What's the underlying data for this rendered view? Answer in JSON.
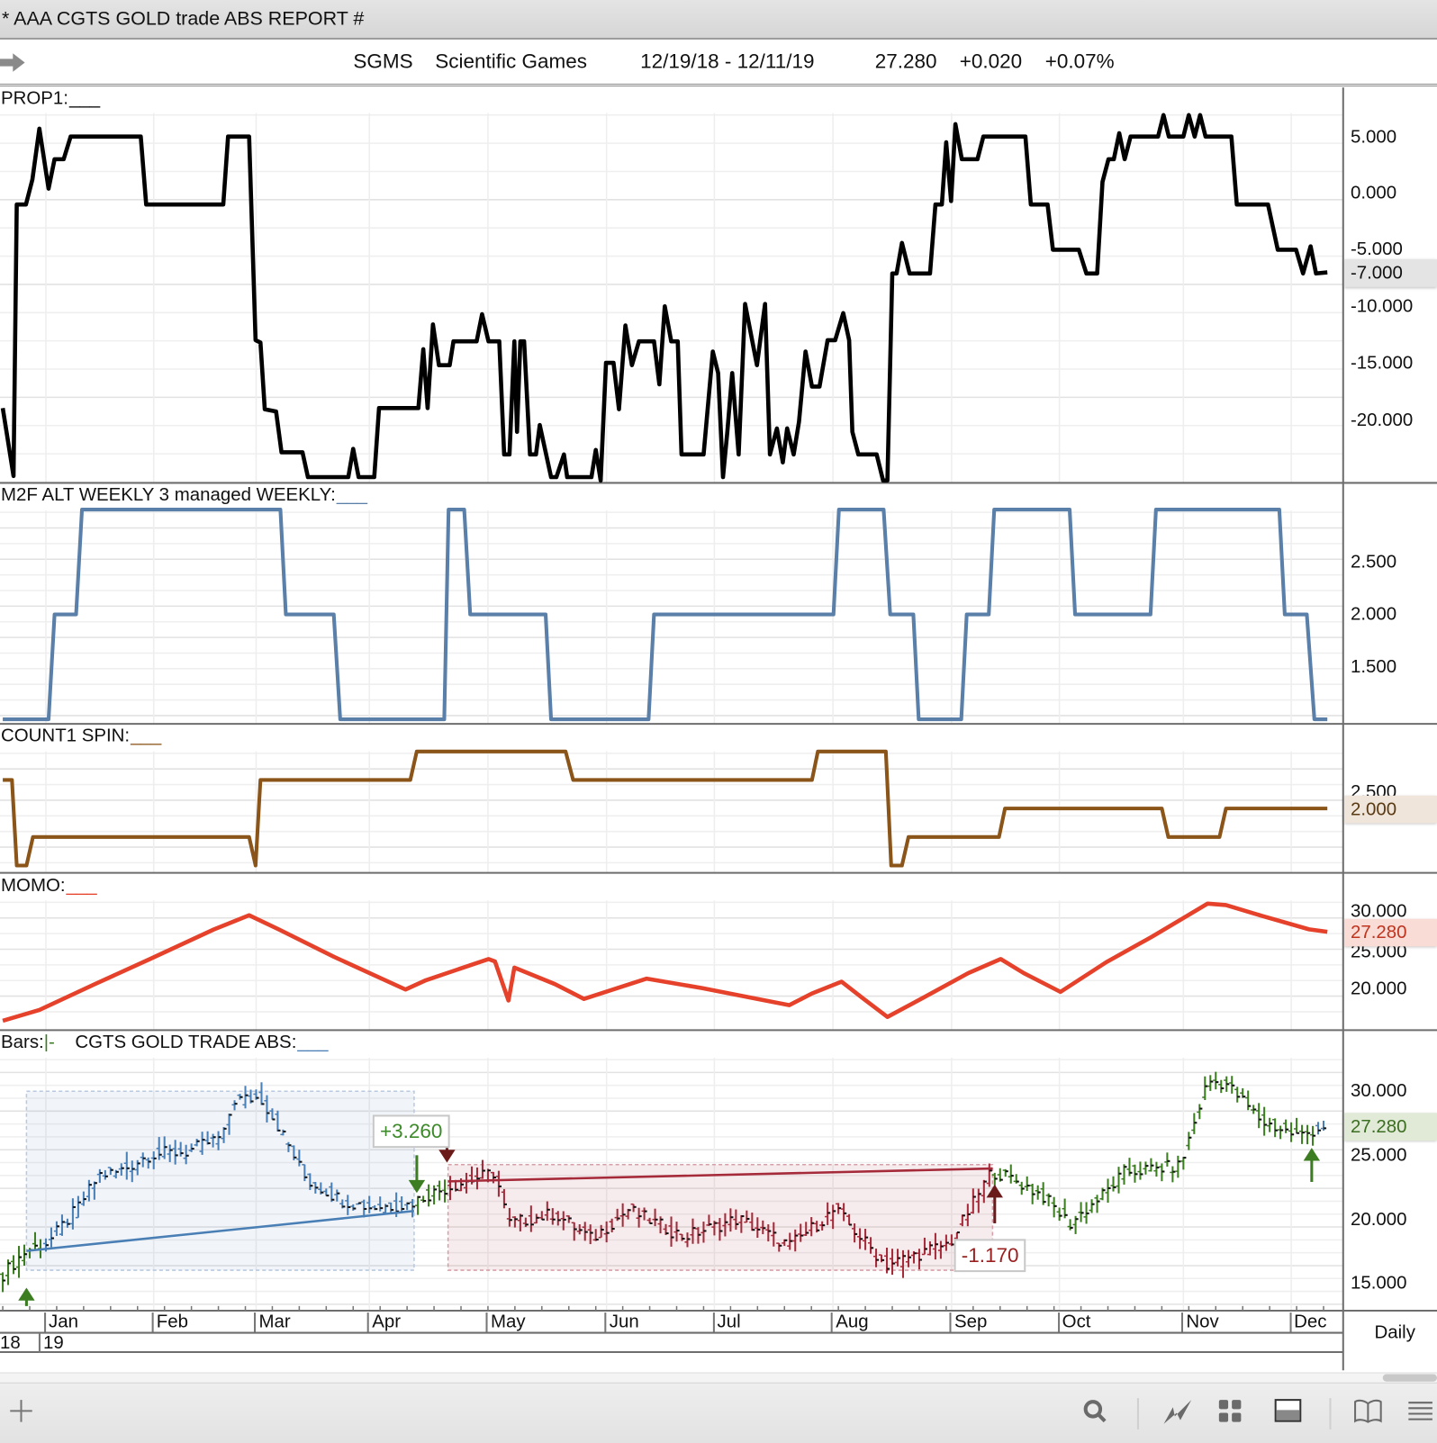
{
  "window": {
    "title": "*  AAA CGTS GOLD trade ABS REPORT #"
  },
  "info": {
    "symbol": "SGMS",
    "name": "Scientific Games",
    "range": "12/19/18 - 12/11/19",
    "last": "27.280",
    "change": "+0.020",
    "change_pct": "+0.07%"
  },
  "panels": {
    "prop1": {
      "label": "PROP1:",
      "underline": "___",
      "color": "#000000",
      "ticks": [
        "5.000",
        "0.000",
        "-5.000",
        "-10.000",
        "-15.000",
        "-20.000"
      ],
      "last": "-7.000"
    },
    "m2f": {
      "label": "M2F ALT WEEKLY 3 managed WEEKLY:",
      "underline": "___",
      "color": "#5a7fa8",
      "ticks": [
        "2.500",
        "2.000",
        "1.500"
      ]
    },
    "count1": {
      "label": "COUNT1 SPIN:",
      "underline": "___",
      "color": "#8b5418",
      "ticks": [
        "2.500"
      ],
      "last": "2.000"
    },
    "momo": {
      "label": "MOMO:",
      "underline": "___",
      "color": "#e6412a",
      "ticks": [
        "30.000",
        "25.000",
        "20.000"
      ],
      "last": "27.280"
    },
    "bars": {
      "label": "Bars:",
      "bar_glyph": "|-",
      "study": "CGTS  GOLD TRADE ABS:",
      "underline": "___",
      "color": "#4a7fb5",
      "ticks": [
        "30.000",
        "25.000",
        "20.000",
        "15.000"
      ],
      "last": "27.280"
    }
  },
  "xaxis": {
    "months": [
      {
        "label": "Jan",
        "t": 8
      },
      {
        "label": "Feb",
        "t": 28
      },
      {
        "label": "Mar",
        "t": 47
      },
      {
        "label": "Apr",
        "t": 68
      },
      {
        "label": "May",
        "t": 90
      },
      {
        "label": "Jun",
        "t": 112
      },
      {
        "label": "Jul",
        "t": 132
      },
      {
        "label": "Aug",
        "t": 154
      },
      {
        "label": "Sep",
        "t": 176
      },
      {
        "label": "Oct",
        "t": 196
      },
      {
        "label": "Nov",
        "t": 219
      },
      {
        "label": "Dec",
        "t": 239
      }
    ],
    "years": [
      {
        "label": "18",
        "t": 0
      },
      {
        "label": "19",
        "t": 8
      }
    ],
    "period": "Daily"
  },
  "annotations": {
    "gain": "+3.260",
    "loss": "-1.170"
  },
  "colors": {
    "green": "#3c7d22",
    "blue": "#4a7fb5",
    "red": "#a52a3a",
    "darkred": "#6b1a1a"
  },
  "chart_data": [
    {
      "type": "line",
      "title": "PROP1",
      "ylim": [
        -25.6,
        9.3
      ],
      "x_unit": "trading day since 12/19/18",
      "points": [
        [
          0,
          -19
        ],
        [
          2,
          -25
        ],
        [
          2.6,
          -1
        ],
        [
          4.3,
          -1
        ],
        [
          5.5,
          1.2
        ],
        [
          6.8,
          5.7
        ],
        [
          8.5,
          0.4
        ],
        [
          9.6,
          3
        ],
        [
          11.3,
          3
        ],
        [
          12.6,
          5
        ],
        [
          25.6,
          5
        ],
        [
          26.6,
          -1
        ],
        [
          40.9,
          -1
        ],
        [
          41.8,
          5
        ],
        [
          45.7,
          5
        ],
        [
          46.9,
          -13
        ],
        [
          47.8,
          -13.2
        ],
        [
          48.6,
          -19.1
        ],
        [
          50.7,
          -19.3
        ],
        [
          51.7,
          -22.9
        ],
        [
          55.6,
          -22.9
        ],
        [
          56.6,
          -25.1
        ],
        [
          64.1,
          -25.1
        ],
        [
          65,
          -22.6
        ],
        [
          66,
          -25.1
        ],
        [
          68.9,
          -25.1
        ],
        [
          69.8,
          -19
        ],
        [
          77.1,
          -19
        ],
        [
          78,
          -13.8
        ],
        [
          78.8,
          -19
        ],
        [
          79.8,
          -11.6
        ],
        [
          80.9,
          -15.2
        ],
        [
          82.9,
          -15.2
        ],
        [
          83.6,
          -13.1
        ],
        [
          87.9,
          -13.1
        ],
        [
          88.9,
          -10.7
        ],
        [
          90.1,
          -13.1
        ],
        [
          92.1,
          -13.1
        ],
        [
          93,
          -23.1
        ],
        [
          94,
          -23.1
        ],
        [
          94.9,
          -13.1
        ],
        [
          95.4,
          -21.1
        ],
        [
          96,
          -13.1
        ],
        [
          96.7,
          -13.1
        ],
        [
          97.8,
          -23.1
        ],
        [
          98.9,
          -23.1
        ],
        [
          99.6,
          -20.5
        ],
        [
          101.7,
          -25.1
        ],
        [
          102.7,
          -25.1
        ],
        [
          104.1,
          -23.1
        ],
        [
          104.7,
          -25.1
        ],
        [
          109.2,
          -25.1
        ],
        [
          110,
          -22.7
        ],
        [
          110.9,
          -25.4
        ],
        [
          111.9,
          -15
        ],
        [
          113.3,
          -15
        ],
        [
          114.3,
          -19.1
        ],
        [
          115.5,
          -11.7
        ],
        [
          116.7,
          -15.2
        ],
        [
          118,
          -13.1
        ],
        [
          120.8,
          -13.1
        ],
        [
          121.8,
          -16.9
        ],
        [
          122.8,
          -10
        ],
        [
          124,
          -13.1
        ],
        [
          125.2,
          -13.1
        ],
        [
          125.9,
          -23.1
        ],
        [
          130,
          -23.1
        ],
        [
          131.7,
          -14
        ],
        [
          132.7,
          -15.9
        ],
        [
          133.6,
          -25.1
        ],
        [
          134.4,
          -21.1
        ],
        [
          135.3,
          -15.9
        ],
        [
          136.5,
          -23.1
        ],
        [
          137.7,
          -9.8
        ],
        [
          139.9,
          -15.2
        ],
        [
          141.4,
          -9.8
        ],
        [
          142.3,
          -23.1
        ],
        [
          143.6,
          -20.8
        ],
        [
          144.7,
          -23.8
        ],
        [
          145.5,
          -20.8
        ],
        [
          146.7,
          -23.1
        ],
        [
          147.7,
          -20.2
        ],
        [
          148.9,
          -14
        ],
        [
          150.1,
          -17.1
        ],
        [
          151.5,
          -17.1
        ],
        [
          153,
          -13
        ],
        [
          154.4,
          -13
        ],
        [
          155.9,
          -10.6
        ],
        [
          157,
          -13
        ],
        [
          157.6,
          -21.1
        ],
        [
          158.7,
          -23.1
        ],
        [
          162.1,
          -23.1
        ],
        [
          163.3,
          -25.4
        ],
        [
          164.1,
          -25.4
        ],
        [
          165,
          -7.1
        ],
        [
          165.8,
          -7.1
        ],
        [
          166.8,
          -4.4
        ],
        [
          168.2,
          -7.1
        ],
        [
          172,
          -7.1
        ],
        [
          173,
          -1
        ],
        [
          174.2,
          -1
        ],
        [
          175,
          4.5
        ],
        [
          175.9,
          -0.7
        ],
        [
          176.7,
          6.1
        ],
        [
          177.9,
          3
        ],
        [
          180.8,
          3
        ],
        [
          181.9,
          5
        ],
        [
          189.7,
          5
        ],
        [
          190.7,
          -1
        ],
        [
          193.8,
          -1
        ],
        [
          194.8,
          -5
        ],
        [
          199.6,
          -5
        ],
        [
          201,
          -7.1
        ],
        [
          203,
          -7.1
        ],
        [
          204,
          1
        ],
        [
          205.1,
          3
        ],
        [
          206.1,
          3
        ],
        [
          207.1,
          5.3
        ],
        [
          208.1,
          3
        ],
        [
          209.2,
          5
        ],
        [
          214.3,
          5
        ],
        [
          215.3,
          6.9
        ],
        [
          216.3,
          5
        ],
        [
          219,
          5
        ],
        [
          220,
          6.9
        ],
        [
          221.1,
          5
        ],
        [
          222.1,
          6.9
        ],
        [
          223.1,
          5
        ],
        [
          227.9,
          5
        ],
        [
          228.9,
          -1
        ],
        [
          234.7,
          -1
        ],
        [
          236.5,
          -5
        ],
        [
          239.9,
          -5
        ],
        [
          241.2,
          -7.1
        ],
        [
          242.6,
          -4.7
        ],
        [
          243.6,
          -7.1
        ],
        [
          245.7,
          -7
        ]
      ]
    },
    {
      "type": "line",
      "title": "M2F ALT WEEKLY 3 managed WEEKLY",
      "ylim": [
        0.97,
        3.2
      ],
      "points": [
        [
          0,
          1
        ],
        [
          8.5,
          1
        ],
        [
          9.6,
          2
        ],
        [
          13.6,
          2
        ],
        [
          14.7,
          3
        ],
        [
          51.5,
          3
        ],
        [
          52.5,
          2
        ],
        [
          61.4,
          2
        ],
        [
          62.6,
          1
        ],
        [
          81.9,
          1
        ],
        [
          82.7,
          3
        ],
        [
          85.6,
          3
        ],
        [
          86.7,
          2
        ],
        [
          100.7,
          2
        ],
        [
          101.7,
          1
        ],
        [
          119.8,
          1
        ],
        [
          120.8,
          2
        ],
        [
          154.1,
          2
        ],
        [
          155.1,
          3
        ],
        [
          163.4,
          3
        ],
        [
          164.6,
          2
        ],
        [
          168.9,
          2
        ],
        [
          169.9,
          1
        ],
        [
          177.8,
          1
        ],
        [
          178.8,
          2
        ],
        [
          182.9,
          2
        ],
        [
          183.9,
          3
        ],
        [
          197.9,
          3
        ],
        [
          198.9,
          2
        ],
        [
          212.9,
          2
        ],
        [
          213.9,
          3
        ],
        [
          236.8,
          3
        ],
        [
          237.8,
          2
        ],
        [
          241.9,
          2
        ],
        [
          243.3,
          1
        ],
        [
          245.7,
          1
        ]
      ]
    },
    {
      "type": "line",
      "title": "COUNT1 SPIN",
      "ylim": [
        -0.2,
        5
      ],
      "points": [
        [
          0,
          3
        ],
        [
          1.7,
          3
        ],
        [
          2.6,
          0
        ],
        [
          4.4,
          0
        ],
        [
          5.6,
          1
        ],
        [
          45.7,
          1
        ],
        [
          46.9,
          0
        ],
        [
          47.8,
          3
        ],
        [
          75.6,
          3
        ],
        [
          76.8,
          4
        ],
        [
          104.4,
          4
        ],
        [
          105.8,
          3
        ],
        [
          150.1,
          3
        ],
        [
          151.2,
          4
        ],
        [
          163.8,
          4
        ],
        [
          164.8,
          0
        ],
        [
          166.8,
          0
        ],
        [
          168,
          1
        ],
        [
          184.8,
          1
        ],
        [
          185.9,
          2
        ],
        [
          215,
          2
        ],
        [
          216.2,
          1
        ],
        [
          225.7,
          1
        ],
        [
          226.9,
          2
        ],
        [
          245.7,
          2
        ]
      ]
    },
    {
      "type": "line",
      "title": "MOMO",
      "ylim": [
        15.6,
        34.4
      ],
      "points": [
        [
          0,
          15.9
        ],
        [
          6.8,
          17.3
        ],
        [
          17.1,
          20.6
        ],
        [
          27.3,
          23.8
        ],
        [
          39.2,
          27.6
        ],
        [
          45.7,
          29.4
        ],
        [
          51.2,
          27.6
        ],
        [
          61.4,
          24.1
        ],
        [
          74.7,
          19.9
        ],
        [
          78.5,
          21.1
        ],
        [
          90.1,
          23.8
        ],
        [
          91.3,
          23.5
        ],
        [
          93.8,
          18.5
        ],
        [
          94.9,
          22.7
        ],
        [
          102.4,
          20.6
        ],
        [
          107.8,
          18.7
        ],
        [
          119.4,
          21.3
        ],
        [
          129.7,
          20.1
        ],
        [
          139.9,
          18.7
        ],
        [
          145.9,
          17.9
        ],
        [
          150.1,
          19.4
        ],
        [
          155.6,
          20.9
        ],
        [
          159.5,
          18.8
        ],
        [
          164.1,
          16.4
        ],
        [
          170.6,
          18.8
        ],
        [
          179.1,
          22
        ],
        [
          185.1,
          23.8
        ],
        [
          189.4,
          22
        ],
        [
          196.2,
          19.6
        ],
        [
          204.7,
          23.4
        ],
        [
          213.3,
          26.7
        ],
        [
          223.5,
          30.9
        ],
        [
          226.9,
          30.7
        ],
        [
          233.7,
          29.3
        ],
        [
          242.3,
          27.6
        ],
        [
          245.7,
          27.28
        ]
      ]
    },
    {
      "type": "ohlc",
      "title": "CGTS GOLD TRADE ABS",
      "ylim": [
        13.0,
        34.5
      ],
      "close_anchors": [
        [
          0,
          15.7
        ],
        [
          4.3,
          17.5
        ],
        [
          8.5,
          18.2
        ],
        [
          13.6,
          20.7
        ],
        [
          17.9,
          23.4
        ],
        [
          21.3,
          23.6
        ],
        [
          27.3,
          25
        ],
        [
          34.1,
          25.2
        ],
        [
          40.9,
          26.4
        ],
        [
          42.7,
          29.2
        ],
        [
          47.8,
          29.4
        ],
        [
          51.2,
          27.1
        ],
        [
          56.3,
          23
        ],
        [
          63.1,
          21.4
        ],
        [
          68.2,
          20.9
        ],
        [
          75.1,
          21.1
        ],
        [
          78.5,
          21.8
        ],
        [
          83.6,
          22.6
        ],
        [
          91.3,
          23.6
        ],
        [
          93.8,
          19.6
        ],
        [
          102.4,
          20.4
        ],
        [
          109.2,
          18.4
        ],
        [
          116,
          20.7
        ],
        [
          126.2,
          18.6
        ],
        [
          136.5,
          20
        ],
        [
          145.9,
          17.9
        ],
        [
          154.4,
          20.7
        ],
        [
          163.8,
          16.4
        ],
        [
          175.7,
          18.1
        ],
        [
          183.4,
          23.7
        ],
        [
          187.7,
          23
        ],
        [
          192.8,
          21.8
        ],
        [
          197.9,
          19.6
        ],
        [
          204.7,
          22.1
        ],
        [
          208.1,
          23.6
        ],
        [
          218.4,
          24.1
        ],
        [
          223.5,
          30.7
        ],
        [
          226.9,
          30.5
        ],
        [
          233.7,
          27.5
        ],
        [
          240.5,
          26.4
        ],
        [
          245.7,
          27.3
        ]
      ],
      "color_segments": [
        {
          "from": 0,
          "to": 7.9,
          "color": "green"
        },
        {
          "from": 8,
          "to": 76.5,
          "color": "blue"
        },
        {
          "from": 76.6,
          "to": 82.4,
          "color": "green"
        },
        {
          "from": 82.5,
          "to": 183.5,
          "color": "red"
        },
        {
          "from": 183.6,
          "to": 243.5,
          "color": "green"
        },
        {
          "from": 243.6,
          "to": 246,
          "color": "blue"
        }
      ],
      "trade_boxes": [
        {
          "from": 4.4,
          "to": 76.3,
          "high": 29.9,
          "low": 16.0,
          "color": "blue",
          "trend": [
            17.5,
            20.6
          ]
        },
        {
          "from": 82.6,
          "to": 183.6,
          "high": 24.2,
          "low": 16.0,
          "color": "red",
          "trend": [
            22.9,
            23.9
          ]
        }
      ],
      "signals": [
        {
          "t": 4.4,
          "dir": "up",
          "color": "green"
        },
        {
          "t": 76.8,
          "dir": "down",
          "color": "green"
        },
        {
          "t": 82.4,
          "dir": "down",
          "color": "darkred"
        },
        {
          "t": 184,
          "dir": "up",
          "color": "darkred"
        },
        {
          "t": 242.8,
          "dir": "up",
          "color": "green"
        }
      ]
    }
  ]
}
